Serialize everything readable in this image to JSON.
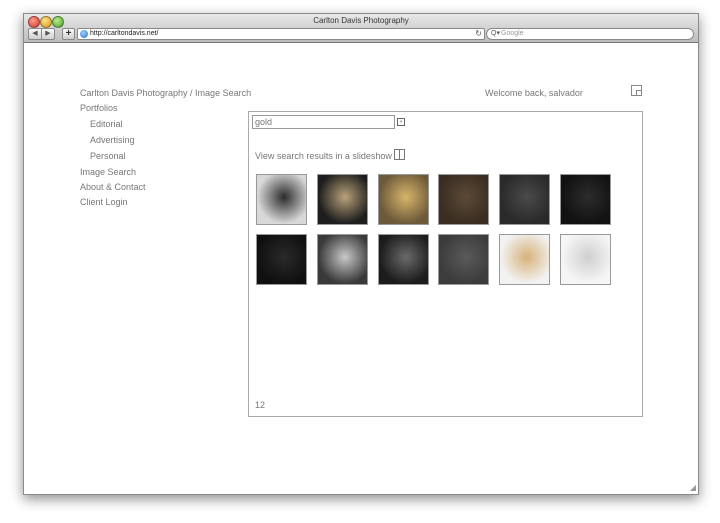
{
  "browser": {
    "window_title": "Carlton Davis Photography",
    "url": "http://carltondavis.net/",
    "search_placeholder": "Google",
    "back_label": "◀",
    "forward_label": "▶",
    "add_label": "+",
    "reload_label": "↻",
    "search_glass": "Q▾"
  },
  "header": {
    "site_title": "Carlton Davis Photography / Image Search",
    "welcome": "Welcome back, salvador"
  },
  "nav": {
    "items": [
      {
        "label": "Portfolios"
      },
      {
        "label": "Editorial"
      },
      {
        "label": "Advertising"
      },
      {
        "label": "Personal"
      },
      {
        "label": "Image Search"
      },
      {
        "label": "About & Contact"
      },
      {
        "label": "Client Login"
      }
    ]
  },
  "search": {
    "query": "gold",
    "go_icon": "»",
    "slideshow_label": "View search results in a slideshow",
    "result_count": "12"
  },
  "thumbnails": [
    {
      "name": "watch-dials",
      "bg": "#d8d8d8",
      "accent": "#2b2b2b"
    },
    {
      "name": "jewelry-dark",
      "bg": "#1e1e1e",
      "accent": "#b9a27a"
    },
    {
      "name": "gold-fabric",
      "bg": "#6d5a3a",
      "accent": "#d7b56a"
    },
    {
      "name": "dark-brown",
      "bg": "#3a2e22",
      "accent": "#5c4a36"
    },
    {
      "name": "dark-fabric",
      "bg": "#2a2a2a",
      "accent": "#4a4a4a"
    },
    {
      "name": "black-dress",
      "bg": "#121212",
      "accent": "#2c2c2c"
    },
    {
      "name": "dark-shape",
      "bg": "#101010",
      "accent": "#2a2a2a"
    },
    {
      "name": "watch-jewels",
      "bg": "#3a3a3a",
      "accent": "#c8c8c8"
    },
    {
      "name": "dark-portrait",
      "bg": "#1c1c1c",
      "accent": "#6a6a6a"
    },
    {
      "name": "grey-paper",
      "bg": "#3c3c3c",
      "accent": "#5a5a5a"
    },
    {
      "name": "white-gold",
      "bg": "#f2f2f2",
      "accent": "#d6b27a"
    },
    {
      "name": "white-figure",
      "bg": "#f6f6f6",
      "accent": "#cfcfcf"
    }
  ]
}
